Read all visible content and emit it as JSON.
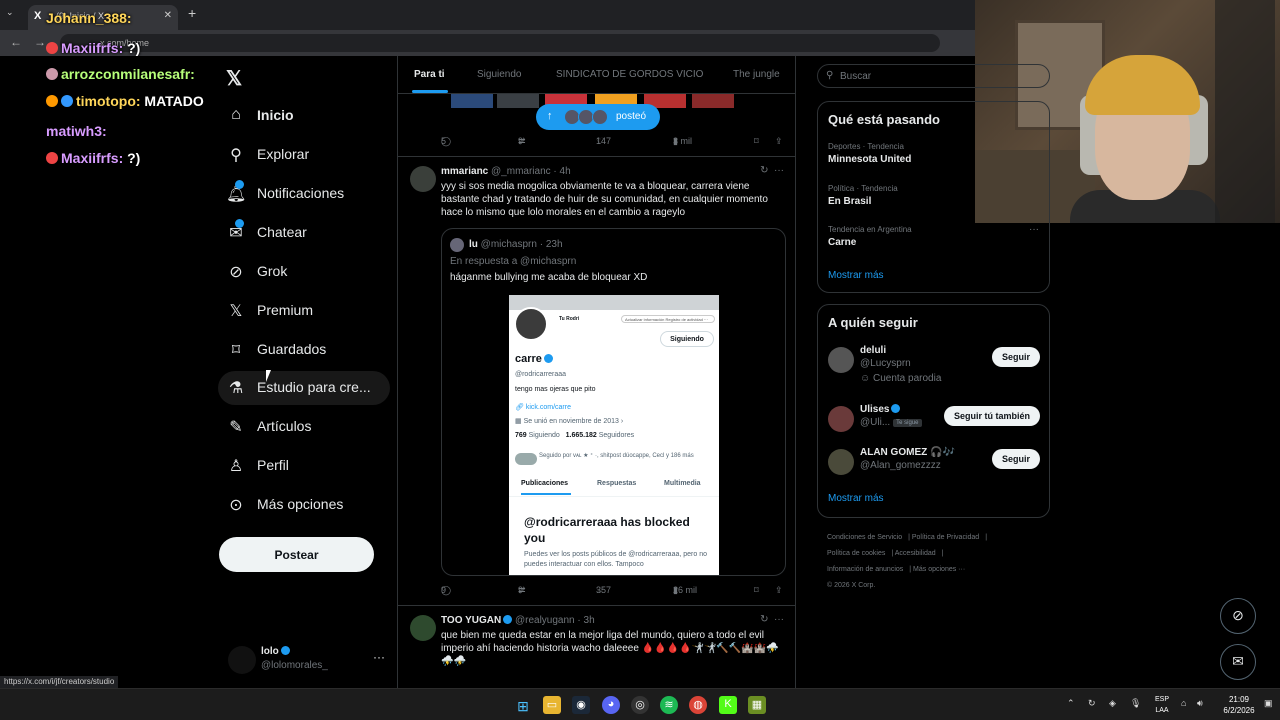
{
  "browser": {
    "tab_title": "(9) Inicio / X",
    "tab_close": "✕",
    "new_tab": "+",
    "url": "x.com/home",
    "status_url": "https://x.com/i/jf/creators/studio"
  },
  "overlay_chat": [
    {
      "user": "Johann_388:",
      "message": ""
    },
    {
      "user": "Maxiifrfs:",
      "message": "?)"
    },
    {
      "user": "arrozconmilanesafr:",
      "message": ""
    },
    {
      "user": "timotopo:",
      "message": "MATADO"
    },
    {
      "user": "matiwh3:",
      "message": ""
    },
    {
      "user": "Maxiifrfs:",
      "message": "?)"
    }
  ],
  "nav": {
    "items": [
      {
        "label": "Inicio",
        "icon": "home-icon"
      },
      {
        "label": "Explorar",
        "icon": "search-icon"
      },
      {
        "label": "Notificaciones",
        "icon": "bell-icon"
      },
      {
        "label": "Chatear",
        "icon": "mail-icon"
      },
      {
        "label": "Grok",
        "icon": "grok-icon"
      },
      {
        "label": "Premium",
        "icon": "x-icon"
      },
      {
        "label": "Guardados",
        "icon": "bookmark-icon"
      },
      {
        "label": "Estudio para cre...",
        "icon": "flask-icon"
      },
      {
        "label": "Artículos",
        "icon": "article-icon"
      },
      {
        "label": "Perfil",
        "icon": "person-icon"
      },
      {
        "label": "Más opciones",
        "icon": "more-circle-icon"
      }
    ],
    "post_button": "Postear",
    "account": {
      "name": "lolo",
      "handle": "@lolomorales_",
      "more": "···"
    }
  },
  "timeline": {
    "tabs": [
      "Para ti",
      "Siguiendo",
      "SINDICATO DE GORDOS VICIO",
      "The jungle"
    ],
    "active_tab": "Para ti",
    "new_posts_pill": "posteó",
    "top_tweet_actions": {
      "replies": "5",
      "retweets": "9",
      "likes": "147",
      "views": "3 mil"
    },
    "tweets": [
      {
        "name": "mmarianc",
        "handle": "@_mmarianc",
        "time": "· 4h",
        "text": "yyy si sos media mogolica obviamente te va a bloquear, carrera viene bastante chad y tratando de huir de su comunidad, en cualquier momento hace lo mismo que lolo morales en el cambio a rageylo",
        "quote": {
          "name": "lu",
          "handle": "@michasprn",
          "time": "· 23h",
          "reply_to": "En respuesta a @michasprn",
          "text": "háganme bullying me acaba de bloquear XD",
          "screenshot": {
            "top_name": "Tu Rodri",
            "top_buttons": "Actualizar información   Registro de actividad   ⋯",
            "follow_btn": "Siguiendo",
            "name": "carre",
            "handle": "@rodricarreraaa",
            "bio": "tengo mas ojeras que pito",
            "link": "kick.com/carre",
            "joined": "Se unió en noviembre de 2013",
            "following_count": "769",
            "following_label": "Siguiendo",
            "followers_count": "1.665.182",
            "followers_label": "Seguidores",
            "followed_by": "Seguido por ᴠᴀʟ ★ ⁺ ·, shitpost dúocappe, Cecl y 186 más",
            "tabs": [
              "Publicaciones",
              "Respuestas",
              "Multimedia"
            ],
            "blocked_title": "@rodricarreraaa has blocked you",
            "blocked_desc": "Puedes ver los posts públicos de @rodricarreraaa, pero no puedes interactuar con ellos. Tampoco"
          }
        },
        "actions": {
          "replies": "9",
          "retweets": "9",
          "likes": "357",
          "views": "26 mil"
        }
      },
      {
        "name": "TOO YUGAN",
        "handle": "@realyugann",
        "time": "· 3h",
        "text": "que bien me queda estar en la mejor liga del mundo, quiero a todo el evil imperio ahí haciendo historia wacho daleeee 🩸🩸🩸🩸🤺🤺🔨🔨🏰🏰⛈️⛈️⛈️"
      }
    ]
  },
  "sidebar": {
    "search_placeholder": "Buscar",
    "trends_title": "Qué está pasando",
    "trends": [
      {
        "category": "Deportes · Tendencia",
        "name": "Minnesota United"
      },
      {
        "category": "Política · Tendencia",
        "name": "En Brasil"
      },
      {
        "category": "Tendencia en Argentina",
        "name": "Carne"
      }
    ],
    "trends_more": "Mostrar más",
    "who_title": "A quién seguir",
    "who": [
      {
        "name": "deluli",
        "handle": "@Lucysprn",
        "extra": "Cuenta parodia",
        "button": "Seguir"
      },
      {
        "name": "Ulises",
        "handle": "@Uli...",
        "badge": "Te sigue",
        "button": "Seguir tú también"
      },
      {
        "name": "ALAN GOMEZ 🎧🎶",
        "handle": "@Alan_gomezzzz",
        "button": "Seguir"
      }
    ],
    "who_more": "Mostrar más",
    "footer": [
      "Condiciones de Servicio",
      "Política de Privacidad",
      "Política de cookies",
      "Accesibilidad",
      "Información de anuncios",
      "Más opciones ···",
      "© 2026 X Corp."
    ]
  },
  "taskbar": {
    "lang_top": "ESP",
    "lang_bottom": "LAA",
    "time": "21:09",
    "date": "6/2/2026"
  },
  "colors": {
    "accent": "#1d9bf0",
    "background": "#000000",
    "border": "#2f3336",
    "muted": "#71767b"
  }
}
